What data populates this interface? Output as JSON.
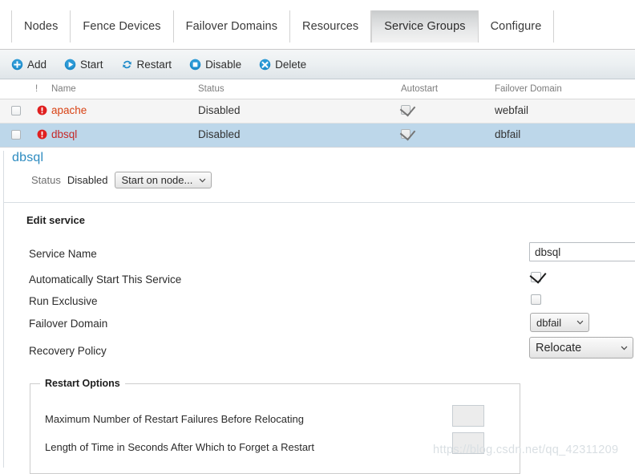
{
  "tabs": [
    {
      "label": "Nodes",
      "active": false
    },
    {
      "label": "Fence Devices",
      "active": false
    },
    {
      "label": "Failover Domains",
      "active": false
    },
    {
      "label": "Resources",
      "active": false
    },
    {
      "label": "Service Groups",
      "active": true
    },
    {
      "label": "Configure",
      "active": false
    }
  ],
  "toolbar": {
    "add_label": "Add",
    "start_label": "Start",
    "restart_label": "Restart",
    "disable_label": "Disable",
    "delete_label": "Delete"
  },
  "table": {
    "headers": {
      "exclamation": "!",
      "name": "Name",
      "status": "Status",
      "autostart": "Autostart",
      "failover_domain": "Failover Domain"
    },
    "rows": [
      {
        "selected": false,
        "checked": false,
        "alert": "error-icon",
        "name": "apache",
        "status": "Disabled",
        "autostart": true,
        "failover_domain": "webfail"
      },
      {
        "selected": true,
        "checked": false,
        "alert": "error-icon",
        "name": "dbsql",
        "status": "Disabled",
        "autostart": true,
        "failover_domain": "dbfail"
      }
    ]
  },
  "detail": {
    "title": "dbsql",
    "status_label": "Status",
    "status_value": "Disabled",
    "start_on_node": "Start on node...",
    "edit_title": "Edit service",
    "fields": {
      "service_name_label": "Service Name",
      "service_name_value": "dbsql",
      "autostart_label": "Automatically Start This Service",
      "autostart_checked": "true",
      "run_exclusive_label": "Run Exclusive",
      "run_exclusive_checked": "false",
      "failover_domain_label": "Failover Domain",
      "failover_domain_value": "dbfail",
      "recovery_policy_label": "Recovery Policy",
      "recovery_policy_value": "Relocate"
    },
    "restart_options": {
      "legend": "Restart Options",
      "max_failures_label": "Maximum Number of Restart Failures Before Relocating",
      "max_failures_value": "",
      "forget_time_label": "Length of Time in Seconds After Which to Forget a Restart",
      "forget_time_value": ""
    }
  },
  "watermark": "https://blog.csdn.net/qq_42311209",
  "colors": {
    "accent_blue": "#2d8bc0",
    "row_selected": "#bdd7ea",
    "error_red": "#e02020",
    "service_name": "#d84315"
  }
}
